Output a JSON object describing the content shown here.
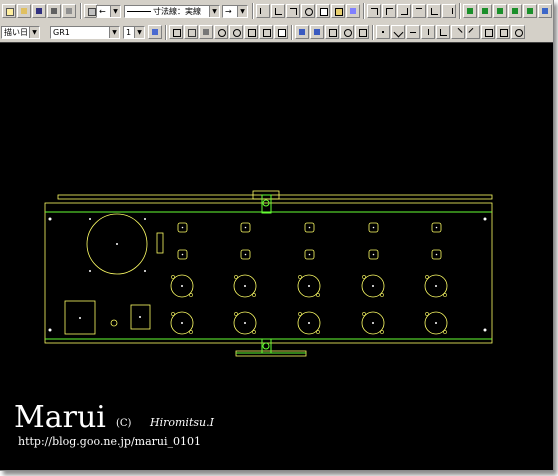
{
  "toolbar": {
    "arrow_start_value": "←",
    "line_type_value": "寸法線：実線",
    "arrow_end_value": "→"
  },
  "toolbar2": {
    "mode_value": "描い日",
    "group_value": "GR1",
    "layer_value": "1"
  },
  "watermark": {
    "logo": "Marui",
    "copyright": "(C)",
    "author": "Hiromitsu.I",
    "url": "http://blog.goo.ne.jp/marui_0101"
  },
  "colors": {
    "background": "#000000",
    "outline": "#ffff66",
    "highlight": "#66ff33",
    "toolbar": "#d4d0c8"
  },
  "icons": [
    "new-icon",
    "open-icon",
    "save-icon",
    "print-icon",
    "zoom-in-icon",
    "zoom-out-icon",
    "undo-icon",
    "redo-icon",
    "layer-icon",
    "snap-icon"
  ]
}
